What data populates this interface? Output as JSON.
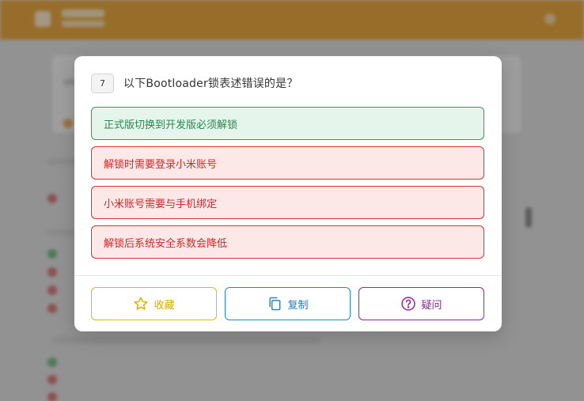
{
  "question": {
    "number": "7",
    "text": "以下Bootloader锁表述错误的是？"
  },
  "options": [
    {
      "label": "正式版切换到开发版必须解锁",
      "status": "correct"
    },
    {
      "label": "解锁时需要登录小米账号",
      "status": "wrong"
    },
    {
      "label": "小米账号需要与手机绑定",
      "status": "wrong"
    },
    {
      "label": "解锁后系统安全系数会降低",
      "status": "wrong"
    }
  ],
  "actions": {
    "favorite_label": "收藏",
    "copy_label": "复制",
    "doubt_label": "疑问"
  },
  "icons": {
    "favorite": "star-icon",
    "copy": "copy-icon",
    "doubt": "question-circle-icon"
  },
  "colors": {
    "header": "#e2961a",
    "correct": "#2f9e5a",
    "wrong": "#d93030",
    "favorite": "#e6b800",
    "copy": "#1a8ad4",
    "doubt": "#9b1fa3"
  }
}
